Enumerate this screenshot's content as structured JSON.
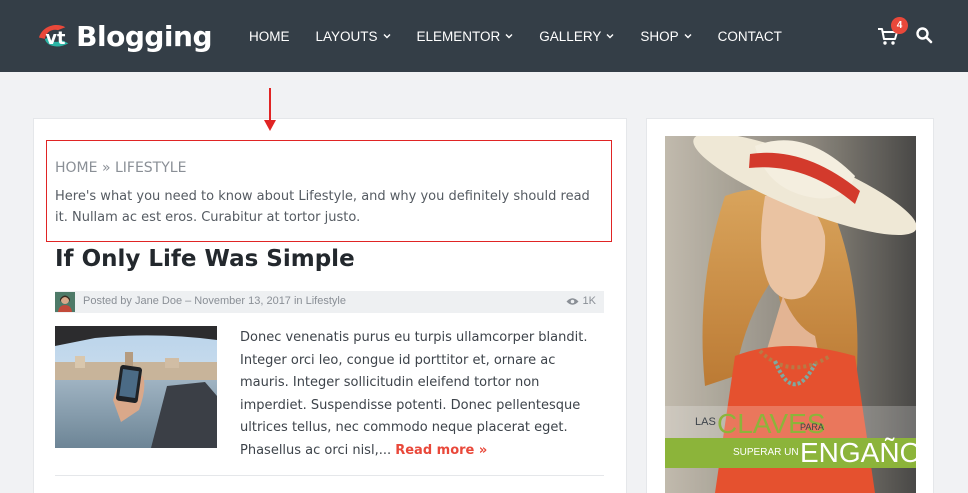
{
  "header": {
    "logo_text": "Blogging",
    "nav": [
      {
        "label": "HOME",
        "has_dropdown": false
      },
      {
        "label": "LAYOUTS",
        "has_dropdown": true
      },
      {
        "label": "ELEMENTOR",
        "has_dropdown": true
      },
      {
        "label": "GALLERY",
        "has_dropdown": true
      },
      {
        "label": "SHOP",
        "has_dropdown": true
      },
      {
        "label": "CONTACT",
        "has_dropdown": false
      }
    ],
    "cart_count": "4",
    "bg_color": "#343e47"
  },
  "breadcrumb": {
    "home": "HOME",
    "separator": "»",
    "current": "LIFESTYLE"
  },
  "category_description": "Here's what you need to know about Lifestyle, and why you definitely should read it. Nullam ac est eros. Curabitur at tortor justo.",
  "post": {
    "title": "If Only Life Was Simple",
    "meta_prefix": "Posted by ",
    "author": "Jane Doe",
    "meta_middle": " – November 13, 2017 in ",
    "category": "Lifestyle",
    "views": "1K",
    "excerpt": "Donec venenatis purus eu turpis ullamcorper blandit. Integer orci leo, congue id porttitor et, ornare ac mauris. Integer sollicitudin eleifend tortor non imperdiet. Suspendisse potenti. Donec pellentesque ultrices tellus, nec commodo neque placerat eget. Phasellus ac orci nisl,... ",
    "read_more": "Read more »"
  },
  "sidebar_ad": {
    "las": "LAS",
    "claves": "CLAVES",
    "para": "PARA",
    "superar_un": "SUPERAR UN",
    "engano": "ENGAÑO"
  },
  "colors": {
    "accent": "#e9483a",
    "highlight_border": "#e02424",
    "ad_green": "#8cb43a"
  }
}
